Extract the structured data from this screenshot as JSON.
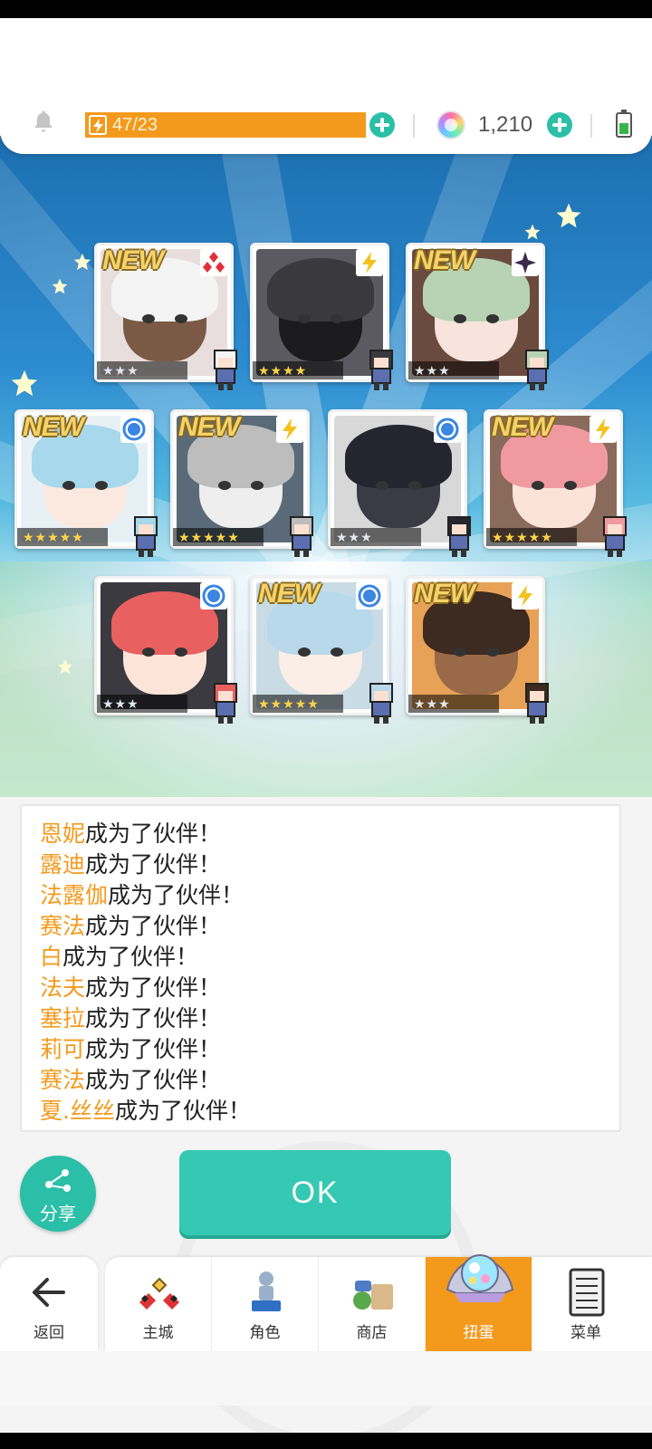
{
  "topbar": {
    "stamina_text": "47/23",
    "gem_count": "1,210"
  },
  "cards": [
    {
      "new": "NEW",
      "attr_icon": "diamond-icon",
      "stars": "★★★",
      "tier": "silver",
      "skin": "#7a5a45",
      "hair": "#f4f4f4",
      "bg": "#e9dede"
    },
    {
      "new": "",
      "attr_icon": "lightning-icon",
      "stars": "★★★★",
      "tier": "gold",
      "skin": "#1b1b1d",
      "hair": "#3a3a3e",
      "bg": "#5a5a60"
    },
    {
      "new": "NEW",
      "attr_icon": "cross-icon",
      "stars": "★★★",
      "tier": "silver",
      "skin": "#f8e4dc",
      "hair": "#b8d3b4",
      "bg": "#6b4b3e"
    },
    {
      "new": "NEW",
      "attr_icon": "circle-icon",
      "stars": "★★★★★",
      "tier": "gold",
      "skin": "#fbe9df",
      "hair": "#a7d8ec",
      "bg": "#e7f1f5"
    },
    {
      "new": "NEW",
      "attr_icon": "lightning-icon",
      "stars": "★★★★★",
      "tier": "gold",
      "skin": "#eeeeee",
      "hair": "#bdbdbd",
      "bg": "#5a6a78"
    },
    {
      "new": "",
      "attr_icon": "circle-icon",
      "stars": "★★★",
      "tier": "silver",
      "skin": "#3b3b46",
      "hair": "#252530",
      "bg": "#d8d8d8"
    },
    {
      "new": "NEW",
      "attr_icon": "lightning-icon",
      "stars": "★★★★★",
      "tier": "gold",
      "skin": "#fbe3d8",
      "hair": "#f09aa0",
      "bg": "#8a6a5a"
    },
    {
      "new": "",
      "attr_icon": "circle-icon",
      "stars": "★★★",
      "tier": "silver",
      "skin": "#fce4d8",
      "hair": "#e86060",
      "bg": "#3a3a40"
    },
    {
      "new": "NEW",
      "attr_icon": "circle-icon",
      "stars": "★★★★★",
      "tier": "gold",
      "skin": "#fbeee6",
      "hair": "#b7d9ea",
      "bg": "#c9dce6"
    },
    {
      "new": "NEW",
      "attr_icon": "lightning-icon",
      "stars": "★★★",
      "tier": "silver",
      "skin": "#9a6a48",
      "hair": "#3d2a20",
      "bg": "#e7a257"
    }
  ],
  "log": {
    "suffix": "成为了伙伴！",
    "names": [
      "恩妮",
      "露迪",
      "法露伽",
      "赛法",
      "白",
      "法夫",
      "塞拉",
      "莉可",
      "赛法",
      "夏.丝丝"
    ]
  },
  "share_label": "分享",
  "ok_label": "OK",
  "nav": {
    "back": "返回",
    "items": [
      "主城",
      "角色",
      "商店",
      "扭蛋",
      "菜单"
    ],
    "active": "扭蛋"
  },
  "colors": {
    "accent": "#2bbfa8",
    "orange": "#f39a1d"
  }
}
